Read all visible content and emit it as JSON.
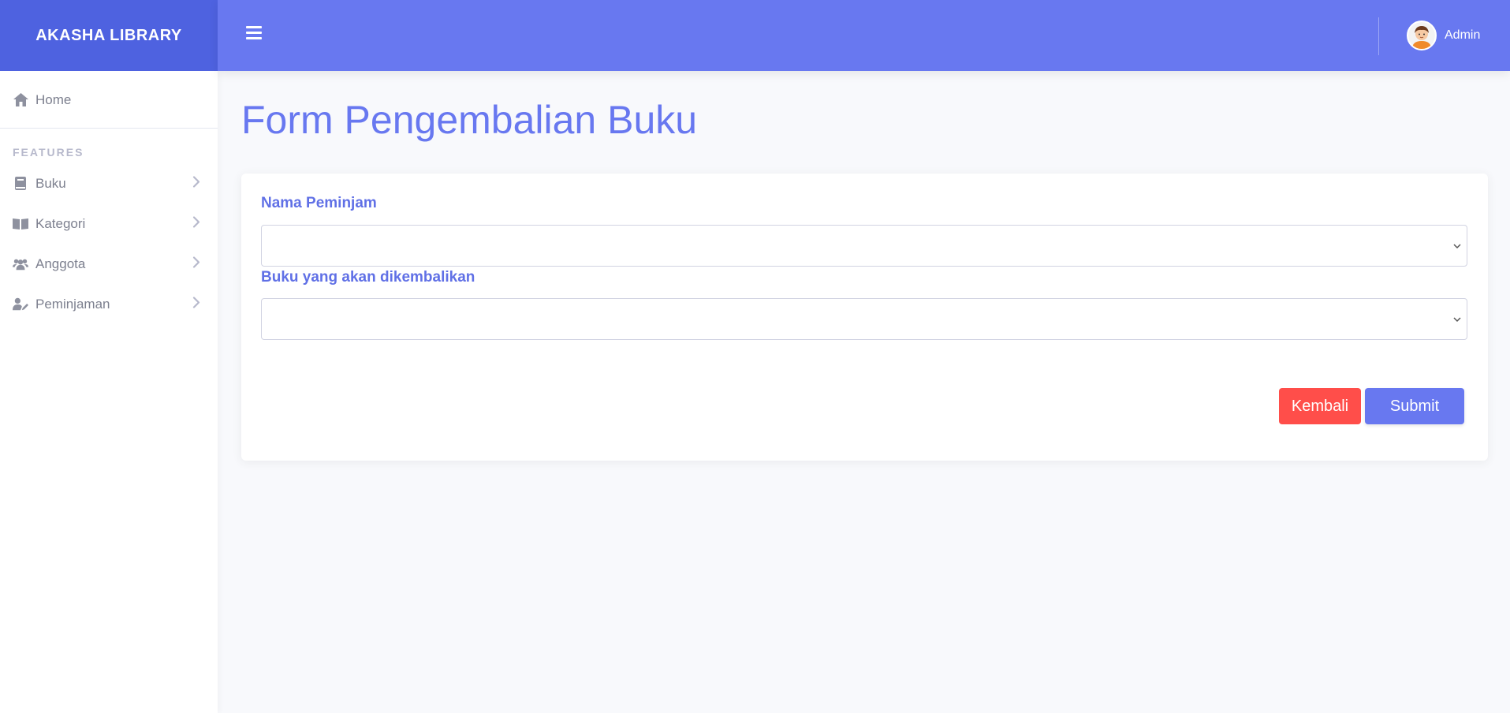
{
  "brand": {
    "name": "AKASHA LIBRARY",
    "color": "#4e62e0"
  },
  "topbar": {
    "color": "#6878f0",
    "menu_icon": "hamburger-icon",
    "user": {
      "name": "Admin",
      "avatar": "avatar-icon"
    }
  },
  "sidebar": {
    "home": {
      "label": "Home",
      "icon": "home-icon"
    },
    "section_heading": "FEATURES",
    "items": [
      {
        "label": "Buku",
        "icon": "book-icon"
      },
      {
        "label": "Kategori",
        "icon": "open-book-icon"
      },
      {
        "label": "Anggota",
        "icon": "users-icon"
      },
      {
        "label": "Peminjaman",
        "icon": "user-edit-icon"
      }
    ]
  },
  "main": {
    "title": "Form Pengembalian Buku",
    "form": {
      "borrower_label": "Nama Peminjam",
      "borrower_value": "",
      "book_label": "Buku yang akan dikembalikan",
      "book_value": ""
    },
    "buttons": {
      "back": "Kembali",
      "submit": "Submit"
    }
  },
  "colors": {
    "accent": "#6878f0",
    "danger": "#ff4e4a",
    "label": "#6070e6"
  }
}
